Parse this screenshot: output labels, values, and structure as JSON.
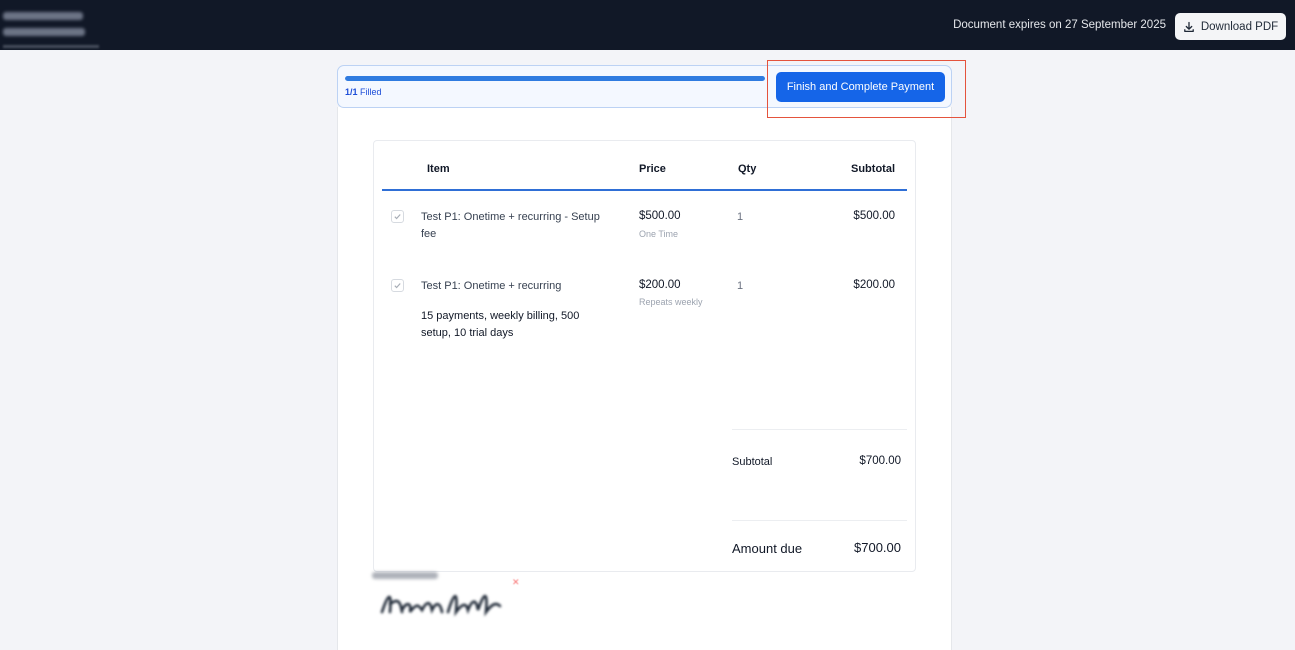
{
  "header": {
    "expiry_text": "Document expires on 27 September 2025",
    "download_label": "Download PDF"
  },
  "progress": {
    "fraction": 1.0,
    "count": "1/1",
    "filled_label": "Filled",
    "finish_label": "Finish and Complete Payment"
  },
  "table": {
    "columns": [
      "Item",
      "Price",
      "Qty",
      "Subtotal"
    ],
    "rows": [
      {
        "name": "Test P1: Onetime + recurring - Setup fee",
        "description": "",
        "price": "$500.00",
        "frequency": "One Time",
        "qty": "1",
        "subtotal": "$500.00"
      },
      {
        "name": "Test P1: Onetime + recurring",
        "description": "15 payments, weekly billing, 500 setup, 10 trial days",
        "price": "$200.00",
        "frequency": "Repeats weekly",
        "qty": "1",
        "subtotal": "$200.00"
      }
    ],
    "subtotal_label": "Subtotal",
    "subtotal_value": "$700.00",
    "amount_due_label": "Amount due",
    "amount_due_value": "$700.00"
  },
  "colors": {
    "header_bg": "#111827",
    "accent": "#1565e8",
    "highlight": "#e4533d"
  }
}
